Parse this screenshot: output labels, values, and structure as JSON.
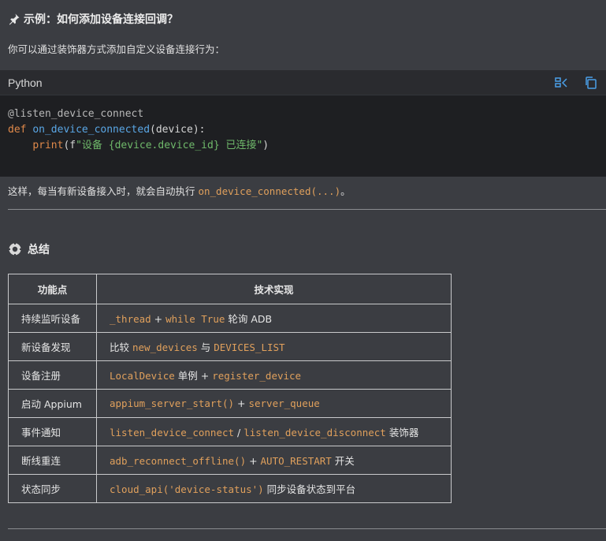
{
  "heading": {
    "icon": "pushpin-icon",
    "text": "示例：如何添加设备连接回调？"
  },
  "intro": "你可以通过装饰器方式添加自定义设备连接行为：",
  "code_block": {
    "language": "Python",
    "actions": [
      "wrap-lines-icon",
      "copy-icon"
    ],
    "lines": [
      [
        {
          "t": "@listen_device_connect",
          "k": "dec"
        }
      ],
      [
        {
          "t": "def ",
          "k": "kw"
        },
        {
          "t": "on_device_connected",
          "k": "fn"
        },
        {
          "t": "(device):",
          "k": "plain"
        }
      ],
      [
        {
          "t": "    ",
          "k": "plain"
        },
        {
          "t": "print",
          "k": "kw"
        },
        {
          "t": "(f",
          "k": "plain"
        },
        {
          "t": "\"设备 {device.device_id} 已连接\"",
          "k": "str"
        },
        {
          "t": ")",
          "k": "plain"
        }
      ]
    ]
  },
  "after_text": {
    "before": "这样，每当有新设备接入时，就会自动执行 ",
    "code": "on_device_connected(...)",
    "after": "。"
  },
  "summary": {
    "icon": "gear-icon",
    "title": "总结"
  },
  "table": {
    "headers": [
      "功能点",
      "技术实现"
    ],
    "rows": [
      {
        "feature": "持续监听设备",
        "impl": [
          {
            "c": "_thread"
          },
          {
            "t": " + "
          },
          {
            "c": "while True"
          },
          {
            "t": " 轮询 ADB"
          }
        ]
      },
      {
        "feature": "新设备发现",
        "impl": [
          {
            "t": "比较 "
          },
          {
            "c": "new_devices"
          },
          {
            "t": " 与 "
          },
          {
            "c": "DEVICES_LIST"
          }
        ]
      },
      {
        "feature": "设备注册",
        "impl": [
          {
            "c": "LocalDevice"
          },
          {
            "t": " 单例 + "
          },
          {
            "c": "register_device"
          }
        ]
      },
      {
        "feature": "启动 Appium",
        "impl": [
          {
            "c": "appium_server_start()"
          },
          {
            "t": " + "
          },
          {
            "c": "server_queue"
          }
        ]
      },
      {
        "feature": "事件通知",
        "impl": [
          {
            "c": "listen_device_connect"
          },
          {
            "t": " / "
          },
          {
            "c": "listen_device_disconnect"
          },
          {
            "t": " 装饰器"
          }
        ]
      },
      {
        "feature": "断线重连",
        "impl": [
          {
            "c": "adb_reconnect_offline()"
          },
          {
            "t": " + "
          },
          {
            "c": "AUTO_RESTART"
          },
          {
            "t": " 开关"
          }
        ]
      },
      {
        "feature": "状态同步",
        "impl": [
          {
            "c": "cloud_api('device-status')"
          },
          {
            "t": " 同步设备状态到平台"
          }
        ]
      }
    ]
  },
  "colors": {
    "background": "#3b3d42",
    "code_bg": "#1e1f22",
    "inline_code": "#e0a05c",
    "keyword": "#e0894a",
    "function": "#5aa7e6",
    "string": "#6fb86a",
    "icon_blue": "#4a9fe8"
  }
}
